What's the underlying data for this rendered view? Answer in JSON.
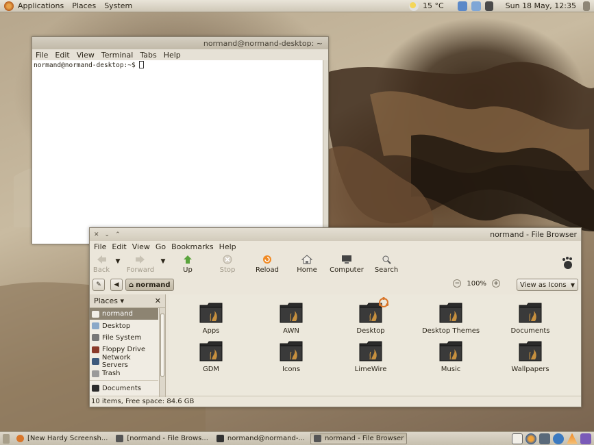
{
  "top_panel": {
    "menus": [
      "Applications",
      "Places",
      "System"
    ],
    "weather": "15 °C",
    "clock": "Sun 18 May, 12:35"
  },
  "terminal": {
    "title": "normand@normand-desktop: ~",
    "menus": [
      "File",
      "Edit",
      "View",
      "Terminal",
      "Tabs",
      "Help"
    ],
    "prompt": "normand@normand-desktop:~$"
  },
  "file_browser": {
    "title": "normand - File Browser",
    "menus": [
      "File",
      "Edit",
      "View",
      "Go",
      "Bookmarks",
      "Help"
    ],
    "toolbar": {
      "back": "Back",
      "forward": "Forward",
      "up": "Up",
      "stop": "Stop",
      "reload": "Reload",
      "home": "Home",
      "computer": "Computer",
      "search": "Search"
    },
    "location": "normand",
    "zoom": "100%",
    "view_mode": "View as Icons",
    "sidebar": {
      "header": "Places",
      "items": [
        {
          "label": "normand",
          "selected": true
        },
        {
          "label": "Desktop"
        },
        {
          "label": "File System"
        },
        {
          "label": "Floppy Drive"
        },
        {
          "label": "Network Servers"
        },
        {
          "label": "Trash"
        },
        {
          "label": "Documents"
        }
      ]
    },
    "items": [
      "Apps",
      "AWN",
      "Desktop",
      "Desktop Themes",
      "Documents",
      "GDM",
      "Icons",
      "LimeWire",
      "Music",
      "Wallpapers"
    ],
    "status": "10 items, Free space: 84.6 GB"
  },
  "taskbar": {
    "tasks": [
      {
        "label": "[New Hardy Screensh...",
        "active": false
      },
      {
        "label": "[normand - File Brows...",
        "active": false
      },
      {
        "label": "normand@normand-...",
        "active": false
      },
      {
        "label": "normand - File Browser",
        "active": true
      }
    ]
  },
  "colors": {
    "panel": "#d8d2c4",
    "selection": "#8d8472",
    "folder": "#2b2b2b",
    "folder_accent": "#e0a040"
  }
}
